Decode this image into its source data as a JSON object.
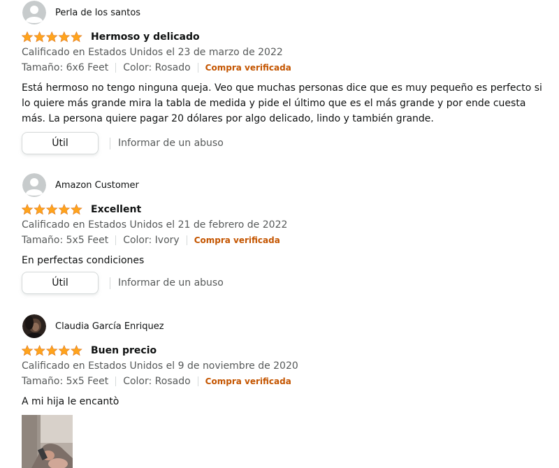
{
  "colors": {
    "star": "#ffa41c",
    "verified": "#c45500",
    "muted_text": "#565959",
    "text": "#0f1111",
    "border": "#d5d9d9"
  },
  "reviews": [
    {
      "reviewer": "Perla de los santos",
      "avatar": "default-avatar-icon",
      "rating": 5,
      "title": "Hermoso y delicado",
      "date": "Calificado en Estados Unidos el 23 de marzo de 2022",
      "size": "Tamaño: 6x6 Feet",
      "color": "Color: Rosado",
      "verified": "Compra verificada",
      "body": "Está hermoso no tengo ninguna queja. Veo que muchas personas dice que es muy pequeño es perfecto si lo quiere más grande mira la tabla de medida y pide el último que es el más grande y por ende cuesta más. La persona quiere pagar 20 dólares por algo delicado, lindo y también grande.",
      "helpful": "Útil",
      "report": "Informar de un abuso"
    },
    {
      "reviewer": "Amazon Customer",
      "avatar": "default-avatar-icon",
      "rating": 5,
      "title": "Excellent",
      "date": "Calificado en Estados Unidos el 21 de febrero de 2022",
      "size": "Tamaño: 5x5 Feet",
      "color": "Color: Ivory",
      "verified": "Compra verificada",
      "body": "En perfectas condiciones",
      "helpful": "Útil",
      "report": "Informar de un abuso"
    },
    {
      "reviewer": "Claudia García Enriquez",
      "avatar": "user-photo-avatar",
      "rating": 5,
      "title": "Buen precio",
      "date": "Calificado en Estados Unidos el 9 de noviembre de 2020",
      "size": "Tamaño: 5x5 Feet",
      "color": "Color: Rosado",
      "verified": "Compra verificada",
      "body": "A mi hija le encantò",
      "photo": "review-photo-thumbnail"
    }
  ]
}
